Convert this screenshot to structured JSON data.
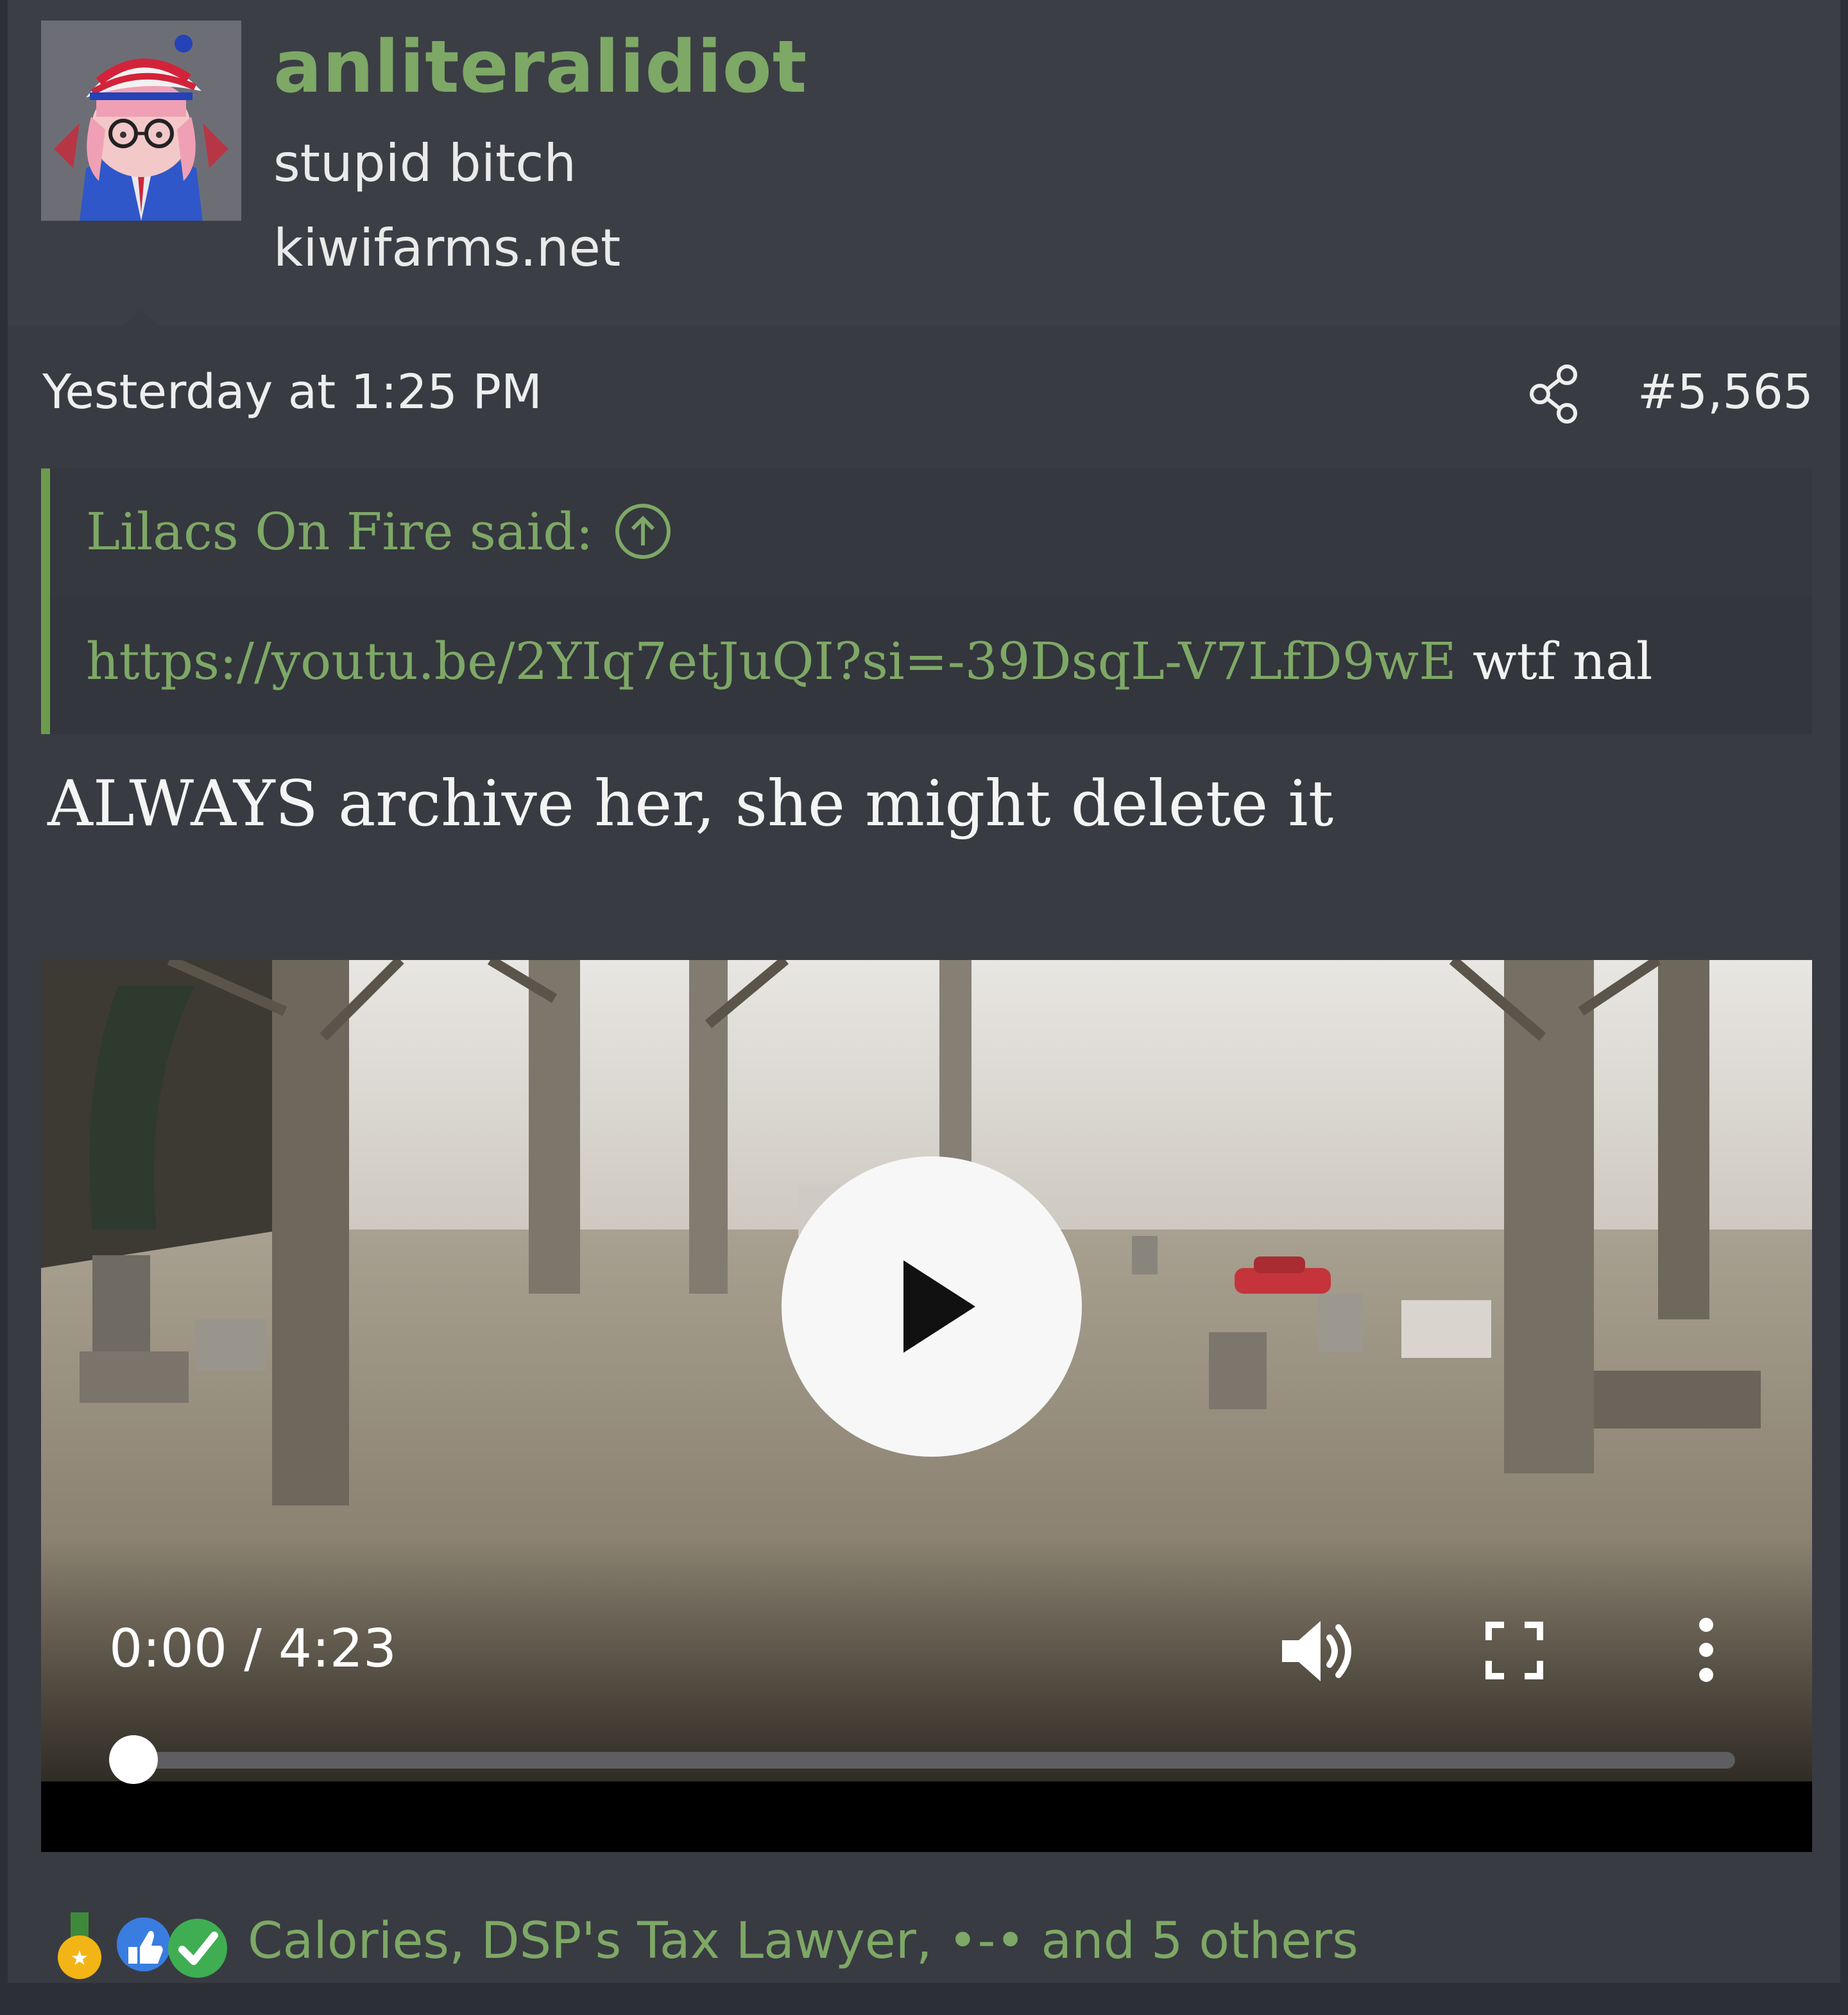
{
  "user": {
    "name": "anliteralidiot",
    "title": "stupid bitch",
    "site": "kiwifarms.net"
  },
  "post": {
    "date": "Yesterday at 1:25 PM",
    "number": "#5,565",
    "body": "ALWAYS archive her, she might delete it"
  },
  "quote": {
    "author": "Lilacs On Fire said:",
    "link": "https://youtu.be/2YIq7etJuQI?si=-39DsqL-V7LfD9wE",
    "text": " wtf nal"
  },
  "video": {
    "time": "0:00 / 4:23",
    "progress": 0
  },
  "reactions": {
    "text": "Calories, DSP's Tax Lawyer, •-• and 5 others",
    "icons": [
      "medal-icon",
      "thumbs-up-icon",
      "check-icon"
    ]
  },
  "colors": {
    "accent": "#7ea866",
    "background": "#383b42",
    "header": "#3b3e45",
    "text": "#eeeeee"
  },
  "icons": {
    "share": "share-icon",
    "quote_jump": "arrow-up-circle-icon",
    "play": "play-icon",
    "volume": "volume-icon",
    "fullscreen": "fullscreen-icon",
    "more": "more-vertical-icon"
  }
}
